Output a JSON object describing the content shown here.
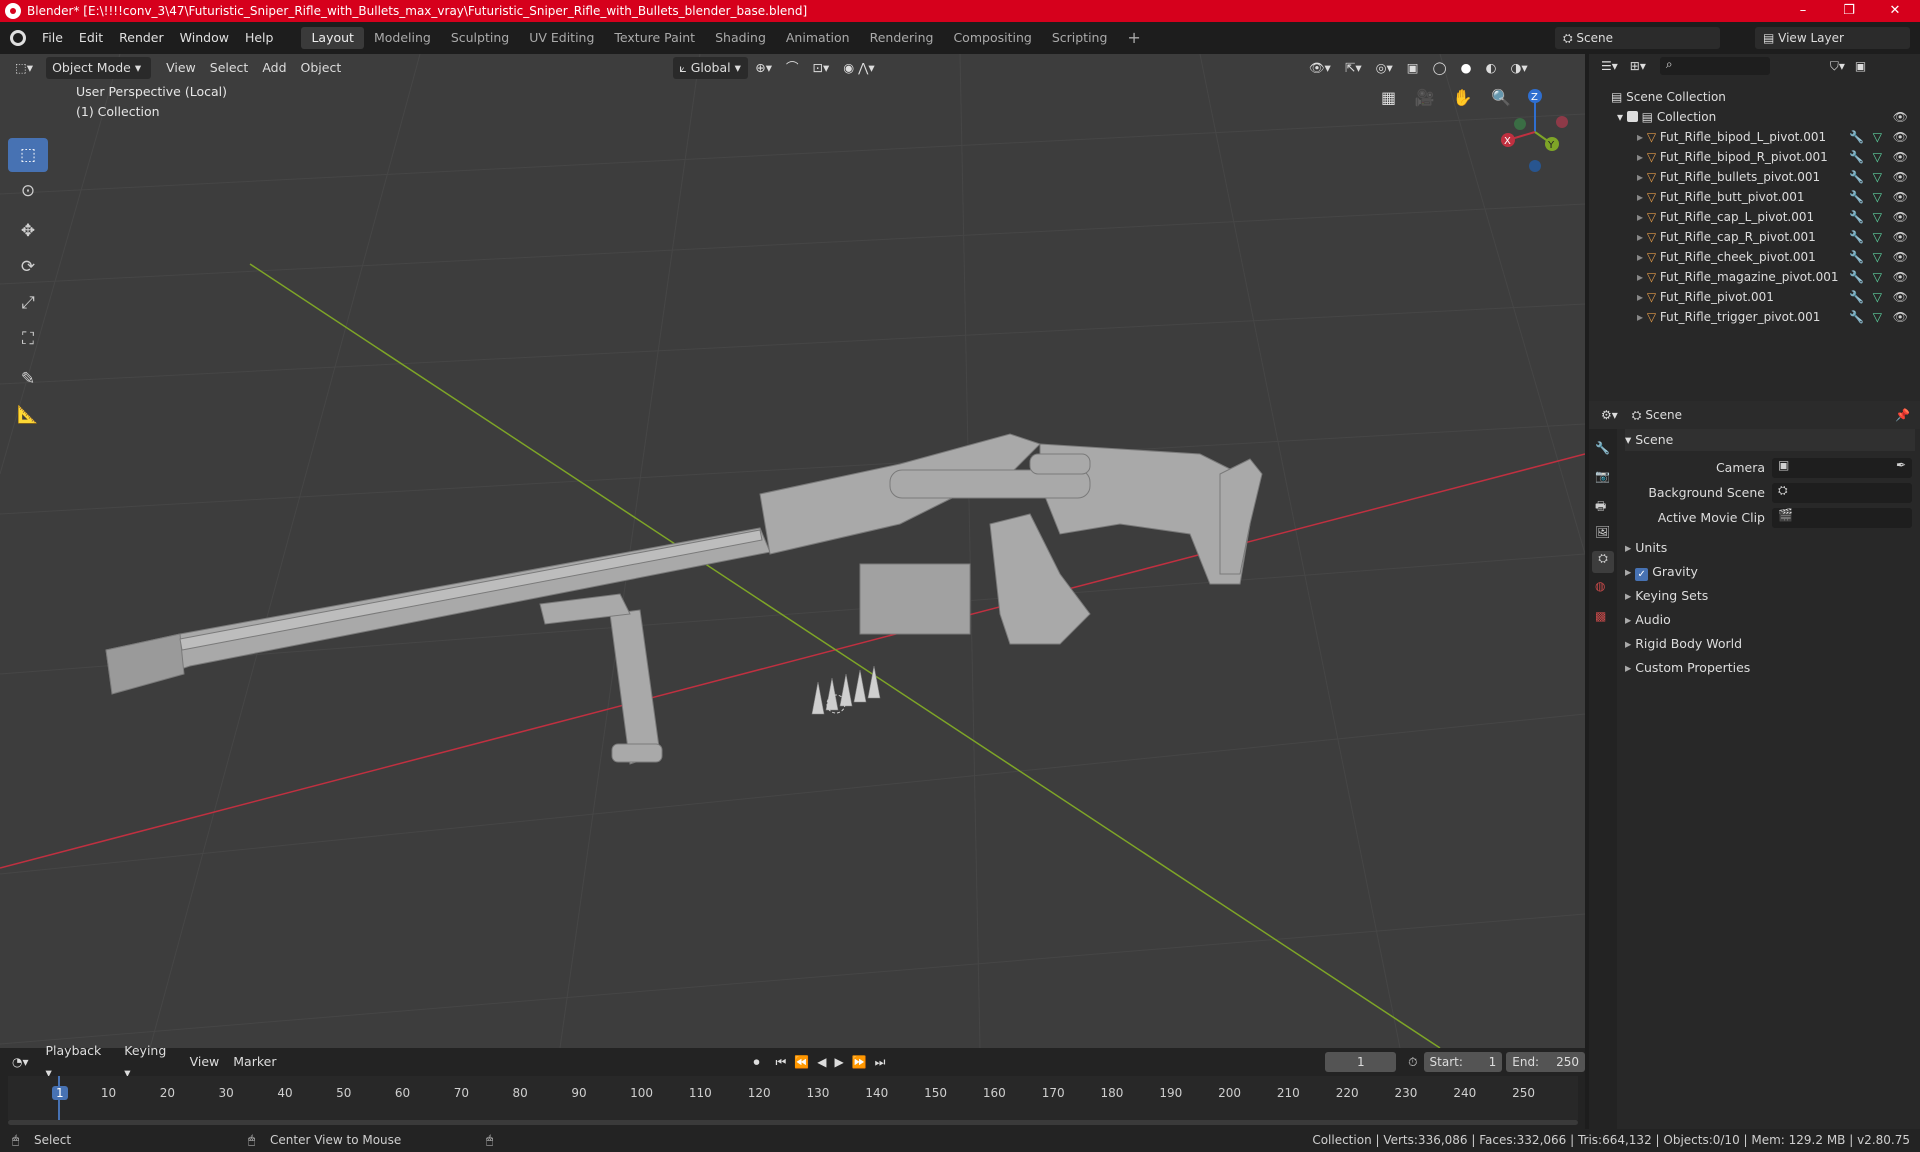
{
  "window": {
    "title": "Blender* [E:\\!!!!conv_3\\47\\Futuristic_Sniper_Rifle_with_Bullets_max_vray\\Futuristic_Sniper_Rifle_with_Bullets_blender_base.blend]",
    "minimize": "–",
    "maximize": "❐",
    "close": "✕"
  },
  "menu": {
    "file": "File",
    "edit": "Edit",
    "render": "Render",
    "window": "Window",
    "help": "Help"
  },
  "workspaces": [
    "Layout",
    "Modeling",
    "Sculpting",
    "UV Editing",
    "Texture Paint",
    "Shading",
    "Animation",
    "Rendering",
    "Compositing",
    "Scripting"
  ],
  "active_workspace": "Layout",
  "scene_field": "Scene",
  "view_layer_field": "View Layer",
  "viewport_header": {
    "mode": "Object Mode",
    "view": "View",
    "select": "Select",
    "add": "Add",
    "object": "Object",
    "transform_orientation": "Global"
  },
  "viewport": {
    "perspective_label": "User Perspective (Local)",
    "collection_label": "(1) Collection",
    "gizmo": {
      "x": "X",
      "y": "Y",
      "z": "Z"
    },
    "colors": {
      "x_axis": "#c03040",
      "y_axis": "#7ea527",
      "z_axis": "#2f6fd0",
      "background": "#3d3d3d",
      "model": "#a8a8a8"
    }
  },
  "outliner": {
    "root": "Scene Collection",
    "collection": "Collection",
    "items": [
      "Fut_Rifle_bipod_L_pivot.001",
      "Fut_Rifle_bipod_R_pivot.001",
      "Fut_Rifle_bullets_pivot.001",
      "Fut_Rifle_butt_pivot.001",
      "Fut_Rifle_cap_L_pivot.001",
      "Fut_Rifle_cap_R_pivot.001",
      "Fut_Rifle_cheek_pivot.001",
      "Fut_Rifle_magazine_pivot.001",
      "Fut_Rifle_pivot.001",
      "Fut_Rifle_trigger_pivot.001"
    ]
  },
  "properties": {
    "context": "Scene",
    "panel": "Scene",
    "camera_label": "Camera",
    "background_scene_label": "Background Scene",
    "active_movie_clip_label": "Active Movie Clip",
    "sections": [
      "Units",
      "Gravity",
      "Keying Sets",
      "Audio",
      "Rigid Body World",
      "Custom Properties"
    ],
    "gravity_checked": true
  },
  "timeline": {
    "playback": "Playback",
    "keying": "Keying",
    "view": "View",
    "marker": "Marker",
    "current_frame": "1",
    "start_label": "Start:",
    "start": "1",
    "end_label": "End:",
    "end": "250",
    "ticks": [
      "1",
      "10",
      "20",
      "30",
      "40",
      "50",
      "60",
      "70",
      "80",
      "90",
      "100",
      "110",
      "120",
      "130",
      "140",
      "150",
      "160",
      "170",
      "180",
      "190",
      "200",
      "210",
      "220",
      "230",
      "240",
      "250"
    ]
  },
  "statusbar": {
    "select": "Select",
    "center_view": "Center View to Mouse",
    "stats": "Collection | Verts:336,086 | Faces:332,066 | Tris:664,132 | Objects:0/10 | Mem: 129.2 MB | v2.80.75"
  }
}
